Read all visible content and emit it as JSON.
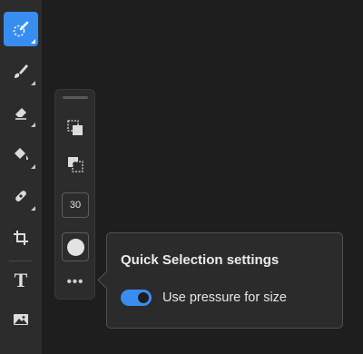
{
  "toolbar": {
    "tools": [
      {
        "name": "quick-selection",
        "icon": "quick-selection-brush-icon",
        "active": true
      },
      {
        "name": "brush",
        "icon": "brush-icon",
        "active": false
      },
      {
        "name": "eraser",
        "icon": "eraser-icon",
        "active": false
      },
      {
        "name": "paint-bucket",
        "icon": "paint-bucket-icon",
        "active": false
      },
      {
        "name": "healing",
        "icon": "bandage-icon",
        "active": false
      },
      {
        "name": "crop",
        "icon": "crop-icon",
        "active": false
      },
      {
        "name": "type",
        "icon": "type-icon",
        "active": false
      },
      {
        "name": "image",
        "icon": "image-icon",
        "active": false
      }
    ],
    "type_glyph": "T"
  },
  "options_bar": {
    "brush_size": "30",
    "more_label": "•••",
    "items": [
      "add-to-selection-icon",
      "subtract-from-selection-icon"
    ]
  },
  "popover": {
    "title": "Quick Selection settings",
    "toggle_label": "Use pressure for size",
    "toggle_on": true
  },
  "colors": {
    "accent": "#378ef0",
    "background": "#1e1e1e",
    "panel": "#2c2c2c"
  }
}
